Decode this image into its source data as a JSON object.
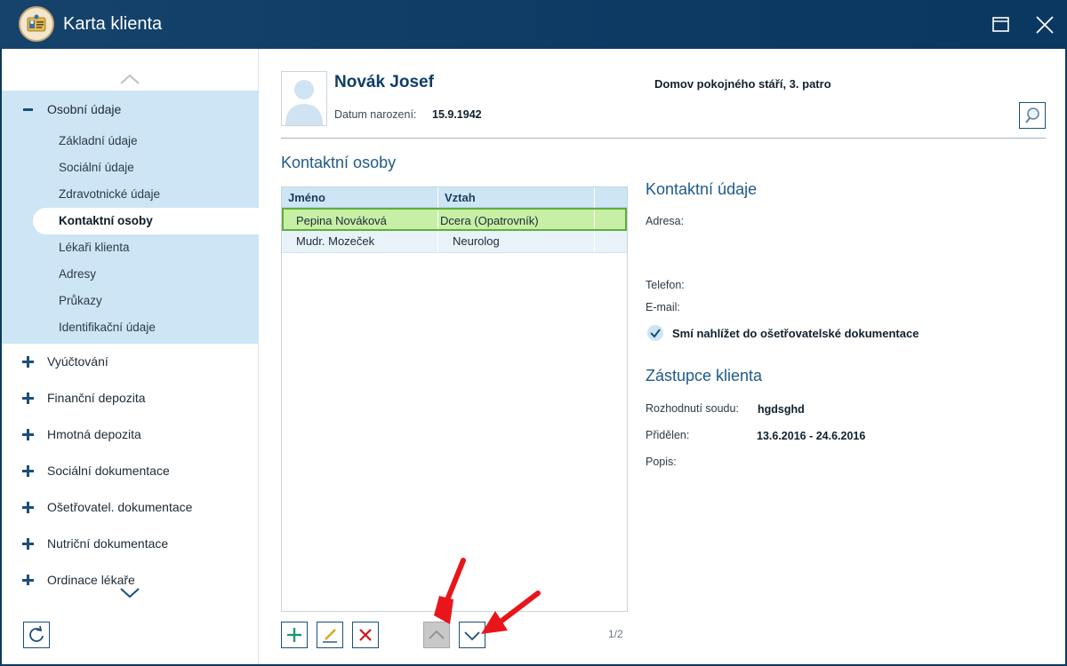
{
  "window": {
    "title": "Karta klienta"
  },
  "sidebar": {
    "open_group": {
      "label": "Osobní údaje",
      "items": [
        {
          "label": "Základní údaje"
        },
        {
          "label": "Sociální údaje"
        },
        {
          "label": "Zdravotnické údaje"
        },
        {
          "label": "Kontaktní osoby",
          "active": true
        },
        {
          "label": "Lékaři klienta"
        },
        {
          "label": "Adresy"
        },
        {
          "label": "Průkazy"
        },
        {
          "label": "Identifikační údaje"
        }
      ]
    },
    "groups": [
      {
        "label": "Vyúčtování"
      },
      {
        "label": "Finanční depozita"
      },
      {
        "label": "Hmotná depozita"
      },
      {
        "label": "Sociální dokumentace"
      },
      {
        "label": "Ošetřovatel. dokumentace"
      },
      {
        "label": "Nutriční dokumentace"
      },
      {
        "label": "Ordinace lékaře"
      }
    ]
  },
  "client": {
    "name": "Novák Josef",
    "dob_label": "Datum narození:",
    "dob": "15.9.1942",
    "facility": "Domov pokojného stáří, 3. patro"
  },
  "contacts": {
    "title": "Kontaktní osoby",
    "columns": [
      "Jméno",
      "Vztah"
    ],
    "rows": [
      {
        "name": "Pepina Nováková",
        "relation": "Dcera (Opatrovník)",
        "selected": true
      },
      {
        "name": "Mudr. Mozeček",
        "relation": "Neurolog",
        "selected": false
      }
    ],
    "pager": "1/2"
  },
  "contact_details": {
    "title": "Kontaktní údaje",
    "address_label": "Adresa:",
    "phone_label": "Telefon:",
    "email_label": "E-mail:",
    "permission": "Smí nahlížet do ošetřovatelské dokumentace"
  },
  "representative": {
    "title": "Zástupce klienta",
    "decision_label": "Rozhodnutí soudu:",
    "decision_value": "hgdsghd",
    "assigned_label": "Přidělen:",
    "assigned_value": "13.6.2016 - 24.6.2016",
    "description_label": "Popis:"
  },
  "colors": {
    "titlebar": "#0c3a63",
    "accent": "#1b4e7a",
    "selection_green": "#c7efa6",
    "sidebar_highlight": "#cde5f4",
    "annotation_arrow": "#e8161b"
  }
}
